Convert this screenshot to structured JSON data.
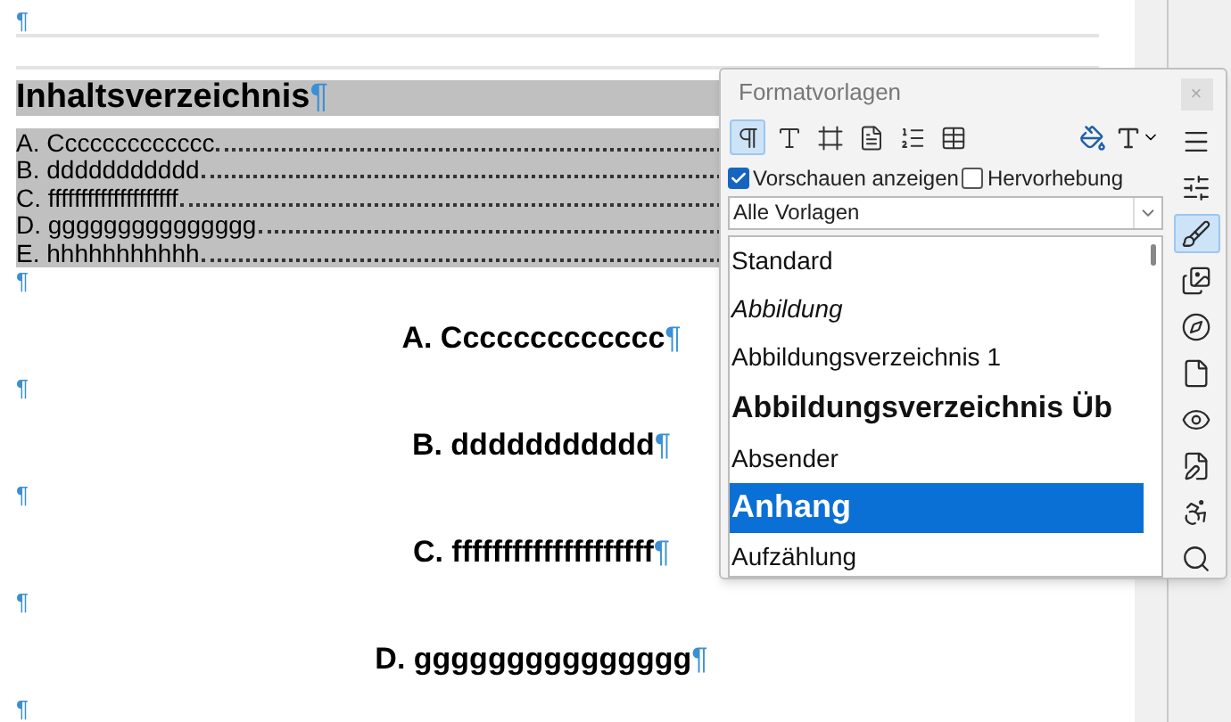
{
  "document": {
    "paragraphs": [
      {
        "kind": "empty",
        "mark": "¶"
      },
      {
        "kind": "toc_title",
        "text": "Inhaltsverzeichnis",
        "mark": "¶"
      },
      {
        "kind": "toc_entry",
        "number": "A.",
        "text": "Ccccccccccccc"
      },
      {
        "kind": "toc_entry",
        "number": "B.",
        "text": "ddddddddddd"
      },
      {
        "kind": "toc_entry",
        "number": "C.",
        "text": "ffffffffffffffffffff"
      },
      {
        "kind": "toc_entry",
        "number": "D.",
        "text": "ggggggggggggggg"
      },
      {
        "kind": "toc_entry",
        "number": "E.",
        "text": "hhhhhhhhhhh"
      },
      {
        "kind": "empty",
        "mark": "¶"
      },
      {
        "kind": "heading",
        "number": "A.",
        "text": "Ccccccccccccc",
        "mark": "¶"
      },
      {
        "kind": "empty",
        "mark": "¶"
      },
      {
        "kind": "heading",
        "number": "B.",
        "text": "ddddddddddd",
        "mark": "¶"
      },
      {
        "kind": "empty",
        "mark": "¶"
      },
      {
        "kind": "heading",
        "number": "C.",
        "text": "ffffffffffffffffffff",
        "mark": "¶"
      },
      {
        "kind": "empty",
        "mark": "¶"
      },
      {
        "kind": "heading",
        "number": "D.",
        "text": "ggggggggggggggg",
        "mark": "¶"
      },
      {
        "kind": "empty",
        "mark": "¶"
      }
    ]
  },
  "panel": {
    "title": "Formatvorlagen",
    "close": "×",
    "families": [
      {
        "kind": "paragraph",
        "selected": true
      },
      {
        "kind": "character",
        "selected": false
      },
      {
        "kind": "frame",
        "selected": false
      },
      {
        "kind": "page",
        "selected": false
      },
      {
        "kind": "list",
        "selected": false
      },
      {
        "kind": "table",
        "selected": false
      }
    ],
    "options": [
      {
        "label": "Vorschauen anzeigen",
        "checked": true
      },
      {
        "label": "Hervorhebung",
        "checked": false
      }
    ],
    "filter": "Alle Vorlagen",
    "styles": [
      {
        "name": "Standard",
        "kind": "plain",
        "selected": false
      },
      {
        "name": "Abbildung",
        "kind": "italic",
        "selected": false
      },
      {
        "name": "Abbildungsverzeichnis 1",
        "kind": "plain",
        "selected": false
      },
      {
        "name": "Abbildungsverzeichnis Üb",
        "kind": "large_bold",
        "selected": false
      },
      {
        "name": "Absender",
        "kind": "plain",
        "selected": false
      },
      {
        "name": "Anhang",
        "kind": "bold",
        "selected": true
      },
      {
        "name": "Aufzählung",
        "kind": "plain",
        "selected": false
      }
    ],
    "tabs": [
      {
        "kind": "menu",
        "selected": false
      },
      {
        "kind": "properties",
        "selected": false
      },
      {
        "kind": "styles",
        "selected": true
      },
      {
        "kind": "gallery",
        "selected": false
      },
      {
        "kind": "navigator",
        "selected": false
      },
      {
        "kind": "page",
        "selected": false
      },
      {
        "kind": "inspector",
        "selected": false
      },
      {
        "kind": "changes",
        "selected": false
      },
      {
        "kind": "accessibility",
        "selected": false
      },
      {
        "kind": "find",
        "selected": false
      }
    ]
  }
}
